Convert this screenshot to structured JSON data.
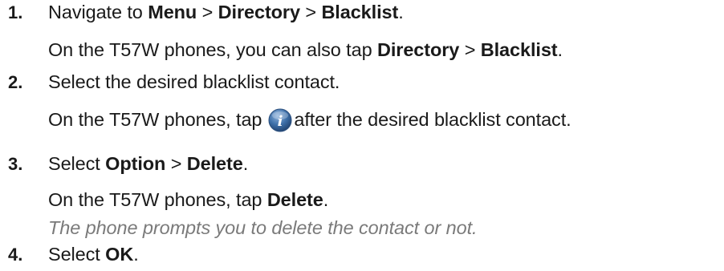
{
  "steps": [
    {
      "number": "1.",
      "main": {
        "prefix": "Navigate to ",
        "b1": "Menu",
        "sep1": " > ",
        "b2": "Directory",
        "sep2": " > ",
        "b3": "Blacklist",
        "suffix": "."
      },
      "sub": {
        "prefix": "On the T57W phones, you can also tap ",
        "b1": "Directory",
        "sep1": " > ",
        "b2": "Blacklist",
        "suffix": "."
      }
    },
    {
      "number": "2.",
      "main": {
        "text": "Select the desired blacklist contact."
      },
      "sub": {
        "prefix": "On the T57W phones, tap",
        "suffix": "after the desired blacklist contact.",
        "icon": "info-icon"
      }
    },
    {
      "number": "3.",
      "main": {
        "prefix": "Select ",
        "b1": "Option",
        "sep1": " > ",
        "b2": "Delete",
        "suffix": "."
      },
      "sub": {
        "prefix": "On the T57W phones, tap ",
        "b1": "Delete",
        "suffix": "."
      },
      "note": "The phone prompts you to delete the contact or not."
    },
    {
      "number": "4.",
      "main": {
        "prefix": "Select ",
        "b1": "OK",
        "suffix": "."
      }
    }
  ],
  "colors": {
    "text": "#1a1a1a",
    "note": "#7a7a7a",
    "icon_fill": "#3d6fa8"
  }
}
